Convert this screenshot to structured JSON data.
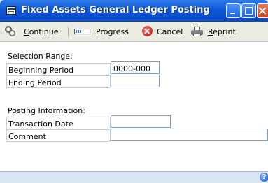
{
  "window": {
    "title": "Fixed Assets General Ledger Posting"
  },
  "toolbar": {
    "continue": {
      "mnemonic": "C",
      "rest": "ontinue"
    },
    "progress": "Progress",
    "cancel": "Cancel",
    "reprint": {
      "mnemonic": "R",
      "rest": "eprint"
    }
  },
  "selection_range": {
    "heading": "Selection Range:",
    "beginning_period": {
      "label": "Beginning Period",
      "value": "0000-000"
    },
    "ending_period": {
      "label": "Ending Period",
      "value": ""
    }
  },
  "posting_information": {
    "heading": "Posting Information:",
    "transaction_date": {
      "label": "Transaction Date",
      "value": ""
    },
    "comment": {
      "label": "Comment",
      "value": ""
    }
  },
  "icons": {
    "window": "window-icon",
    "continue": "gears-icon",
    "progress": "progress-bar-icon",
    "cancel": "cancel-icon",
    "reprint": "printer-icon",
    "help": "help-icon"
  },
  "colors": {
    "titlebar": "#0b58d8",
    "toolbar": "#ecebe2",
    "window_background": "#dbe6f4",
    "field_border": "#7f9db9",
    "cancel_red": "#c8211a"
  }
}
